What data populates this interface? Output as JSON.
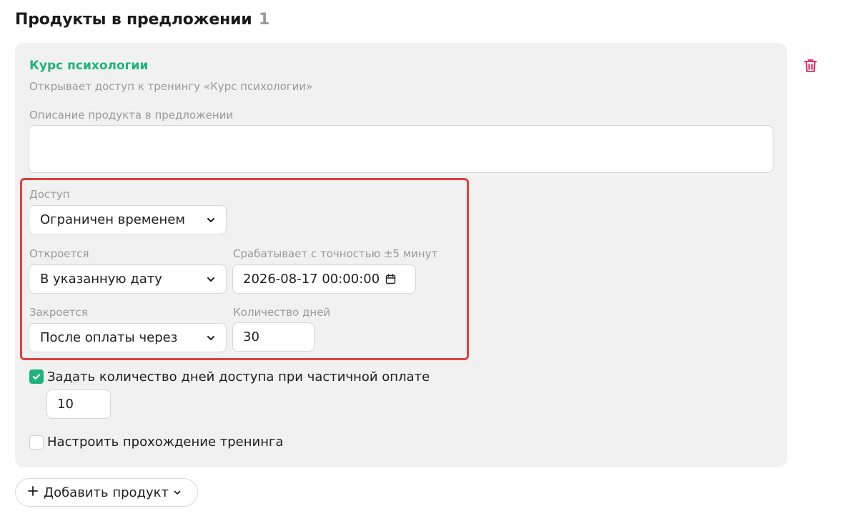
{
  "section": {
    "title": "Продукты в предложении",
    "count": "1"
  },
  "product": {
    "name": "Курс психологии",
    "subtitle": "Открывает доступ к тренингу «Курс психологии»"
  },
  "description": {
    "label": "Описание продукта в предложении",
    "value": "",
    "placeholder": ""
  },
  "access": {
    "label": "Доступ",
    "value": "Ограничен временем",
    "opens_label": "Откроется",
    "opens_value": "В указанную дату",
    "accuracy_label": "Срабатывает с точностью ±5 минут",
    "date_value": "2026-08-17 00:00:00",
    "closes_label": "Закроется",
    "closes_value": "После оплаты через",
    "days_label": "Количество дней",
    "days_value": "30"
  },
  "partial": {
    "checked": true,
    "label": "Задать количество дней доступа при частичной оплате",
    "days_value": "10"
  },
  "training": {
    "checked": false,
    "label": "Настроить прохождение тренинга"
  },
  "add_button": {
    "label": "Добавить продукт"
  },
  "colors": {
    "accent": "#1fb37a",
    "highlight": "#e0413a",
    "trash": "#e0245e",
    "card_bg": "#f1f1f1",
    "muted_text": "#9a9a9a"
  },
  "icons": {
    "trash": "trash-icon",
    "chevron": "chevron-down-icon",
    "calendar": "calendar-icon",
    "check": "check-icon",
    "plus": "plus-icon"
  }
}
